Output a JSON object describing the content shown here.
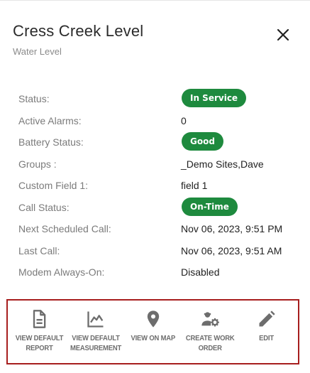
{
  "header": {
    "title": "Cress Creek Level",
    "subtitle": "Water Level"
  },
  "details": [
    {
      "label": "Status:",
      "value": "In Service",
      "type": "badge",
      "color": "#1e8a3e"
    },
    {
      "label": "Active Alarms:",
      "value": "0",
      "type": "text"
    },
    {
      "label": "Battery Status:",
      "value": "Good",
      "type": "badge",
      "color": "#1e8a3e"
    },
    {
      "label": "Groups :",
      "value": "_Demo Sites,Dave",
      "type": "text"
    },
    {
      "label": "Custom Field 1:",
      "value": "field 1",
      "type": "text"
    },
    {
      "label": "Call Status:",
      "value": "On-Time",
      "type": "badge",
      "color": "#1e8a3e"
    },
    {
      "label": "Next Scheduled Call:",
      "value": "Nov 06, 2023, 9:51 PM",
      "type": "text"
    },
    {
      "label": "Last Call:",
      "value": "Nov 06, 2023, 9:51 AM",
      "type": "text"
    },
    {
      "label": "Modem Always-On:",
      "value": "Disabled",
      "type": "text"
    }
  ],
  "actions": [
    {
      "icon": "document-icon",
      "label_line1": "VIEW DEFAULT",
      "label_line2": "REPORT"
    },
    {
      "icon": "chart-line-icon",
      "label_line1": "VIEW DEFAULT",
      "label_line2": "MEASUREMENT"
    },
    {
      "icon": "map-pin-icon",
      "label_line1": "VIEW ON MAP",
      "label_line2": ""
    },
    {
      "icon": "worker-gear-icon",
      "label_line1": "CREATE WORK",
      "label_line2": "ORDER"
    },
    {
      "icon": "pencil-icon",
      "label_line1": "EDIT",
      "label_line2": ""
    }
  ],
  "colors": {
    "badge_green": "#1e8a3e",
    "highlight_border": "#a71e1e",
    "icon_gray": "#6d6d6d"
  }
}
